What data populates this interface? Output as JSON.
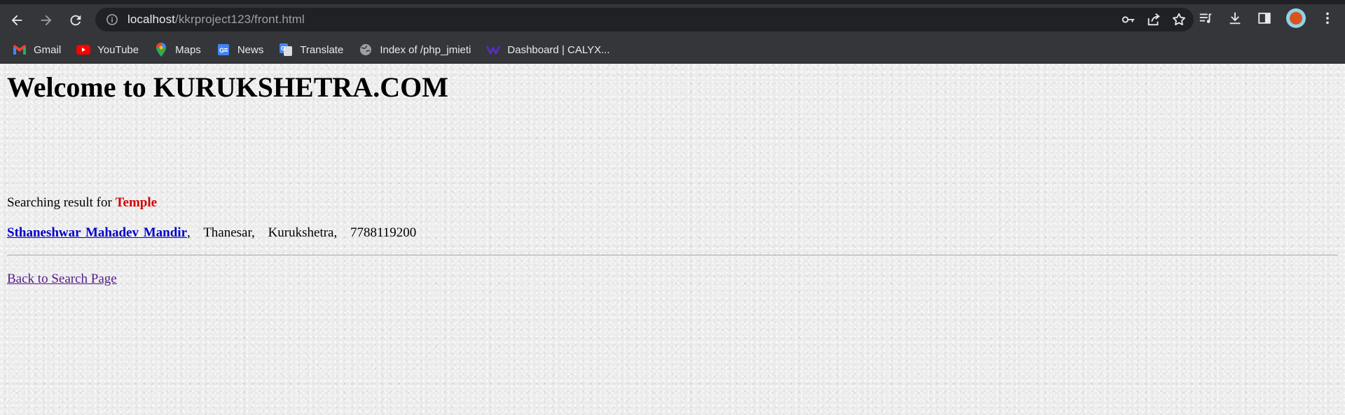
{
  "browser": {
    "url_host": "localhost",
    "url_path": "/kkrproject123/front.html",
    "bookmarks": [
      {
        "label": "Gmail",
        "icon": "gmail-icon"
      },
      {
        "label": "YouTube",
        "icon": "youtube-icon"
      },
      {
        "label": "Maps",
        "icon": "maps-icon"
      },
      {
        "label": "News",
        "icon": "news-icon"
      },
      {
        "label": "Translate",
        "icon": "translate-icon"
      },
      {
        "label": "Index of /php_jmieti",
        "icon": "globe-icon"
      },
      {
        "label": "Dashboard | CALYX...",
        "icon": "calyx-icon"
      }
    ]
  },
  "page": {
    "heading": "Welcome to KURUKSHETRA.COM",
    "search_prefix": "Searching result for",
    "search_term": "Temple",
    "result": {
      "name": "Sthaneshwar Mahadev Mandir",
      "sep": ",",
      "area": "Thanesar,",
      "city": "Kurukshetra,",
      "phone": "7788119200"
    },
    "back_link": "Back to Search Page"
  },
  "colors": {
    "search_term": "#d40000",
    "link": "#0000cc",
    "visited_link": "#551a8b",
    "chrome_bg": "#35363a"
  }
}
